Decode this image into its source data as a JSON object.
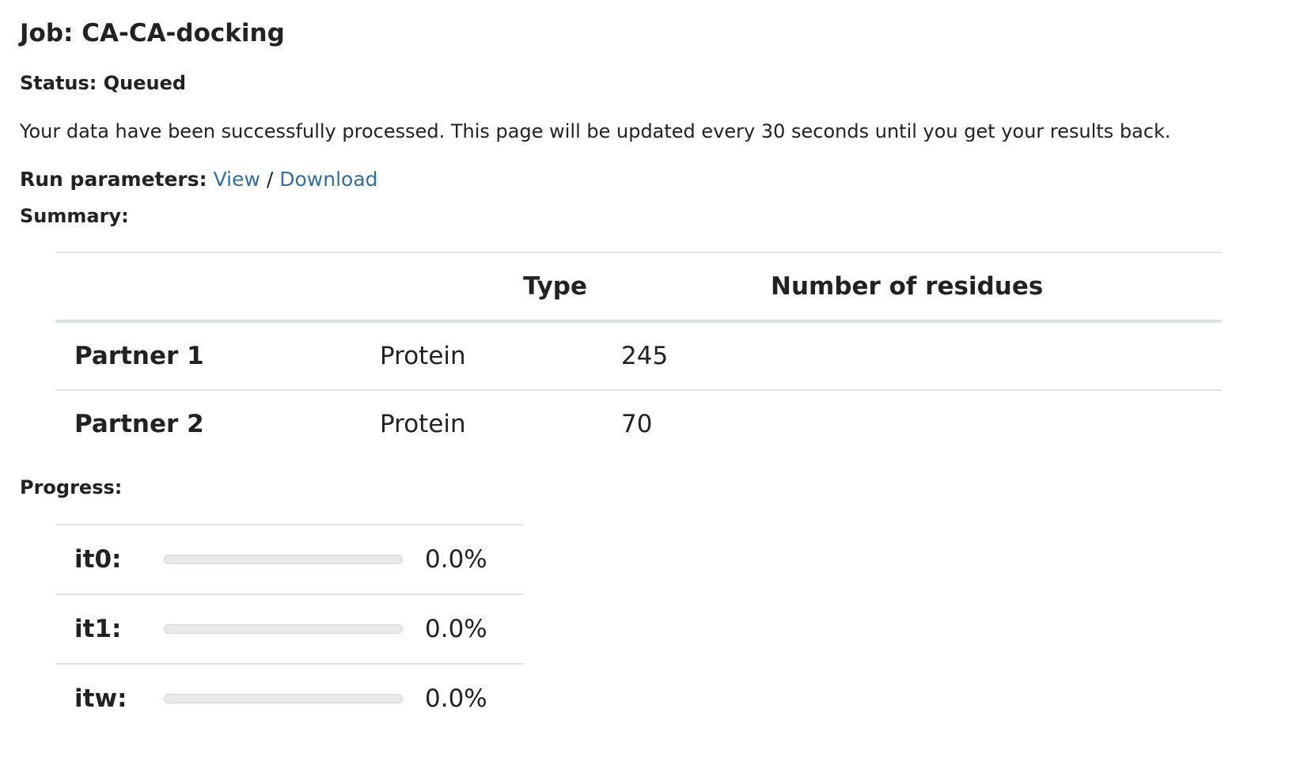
{
  "job": {
    "title": "Job: CA-CA-docking",
    "status": "Status: Queued",
    "message": "Your data have been successfully processed. This page will be updated every 30 seconds until you get your results back."
  },
  "run_parameters": {
    "label": "Run parameters:",
    "view_link": "View",
    "separator": " / ",
    "download_link": "Download"
  },
  "summary": {
    "label": "Summary:",
    "headers": [
      "",
      "Type",
      "Number of residues"
    ],
    "rows": [
      {
        "partner": "Partner 1",
        "type": "Protein",
        "residues": "245"
      },
      {
        "partner": "Partner 2",
        "type": "Protein",
        "residues": "70"
      }
    ]
  },
  "progress": {
    "label": "Progress:",
    "items": [
      {
        "name": "it0:",
        "percent_text": "0.0%",
        "value": 0.0
      },
      {
        "name": "it1:",
        "percent_text": "0.0%",
        "value": 0.0
      },
      {
        "name": "itw:",
        "percent_text": "0.0%",
        "value": 0.0
      }
    ]
  }
}
